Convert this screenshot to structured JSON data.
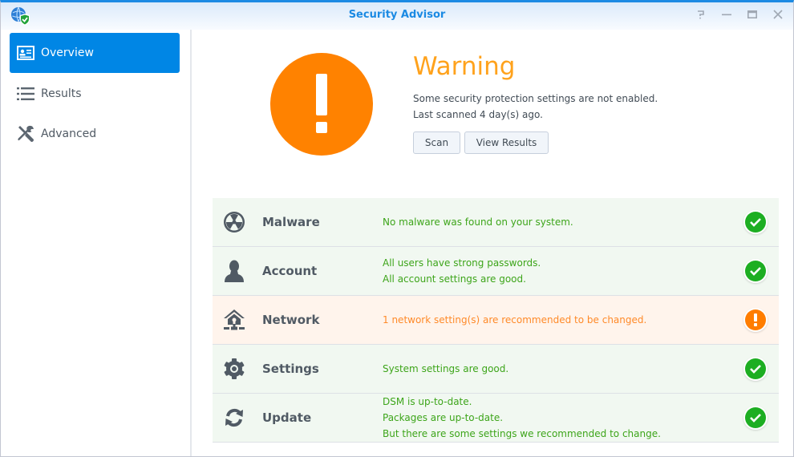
{
  "window": {
    "title": "Security Advisor",
    "controls": [
      "help-icon",
      "minimize-icon",
      "maximize-icon",
      "close-icon"
    ]
  },
  "sidebar": {
    "items": [
      {
        "label": "Overview",
        "icon": "overview-card-icon",
        "active": true
      },
      {
        "label": "Results",
        "icon": "list-icon",
        "active": false
      },
      {
        "label": "Advanced",
        "icon": "wrench-screwdriver-icon",
        "active": false
      }
    ]
  },
  "overview": {
    "status_title": "Warning",
    "status_icon": "warning-exclamation-icon",
    "message": "Some security protection settings are not enabled.",
    "last_scanned": "Last scanned 4 day(s) ago.",
    "buttons": {
      "scan": "Scan",
      "view_results": "View Results"
    },
    "colors": {
      "warning": "#ff8200",
      "ok": "#1dae22",
      "accent": "#0086e5"
    }
  },
  "checks": [
    {
      "name": "Malware",
      "icon": "radiation-icon",
      "status": "ok",
      "lines": [
        "No malware was found on your system."
      ]
    },
    {
      "name": "Account",
      "icon": "user-icon",
      "status": "ok",
      "lines": [
        "All users have strong passwords.",
        "All account settings are good."
      ]
    },
    {
      "name": "Network",
      "icon": "network-house-icon",
      "status": "warning",
      "lines": [
        "1 network setting(s) are recommended to be changed."
      ]
    },
    {
      "name": "Settings",
      "icon": "gear-icon",
      "status": "ok",
      "lines": [
        "System settings are good."
      ]
    },
    {
      "name": "Update",
      "icon": "refresh-icon",
      "status": "ok",
      "lines": [
        "DSM is up-to-date.",
        "Packages are up-to-date.",
        "But there are some settings we recommended to change."
      ]
    }
  ]
}
